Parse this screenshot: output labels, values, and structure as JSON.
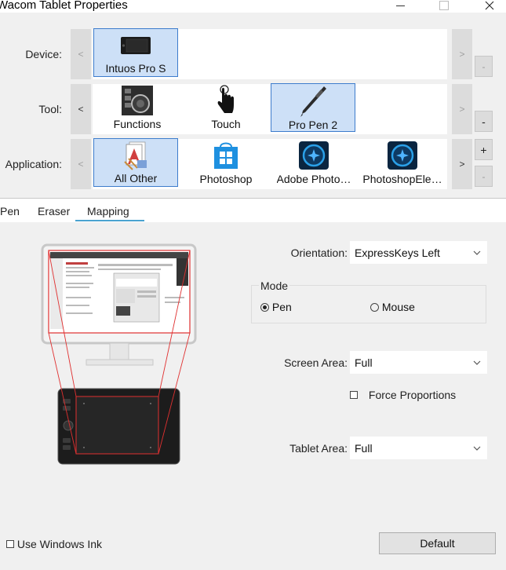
{
  "window": {
    "title": "Wacom Tablet Properties"
  },
  "rows": {
    "device": {
      "label": "Device:",
      "items": [
        {
          "label": "Intuos Pro S",
          "selected": true,
          "icon": "tablet-icon"
        }
      ],
      "side_buttons": [
        "-"
      ]
    },
    "tool": {
      "label": "Tool:",
      "items": [
        {
          "label": "Functions",
          "selected": false,
          "icon": "functions-icon"
        },
        {
          "label": "Touch",
          "selected": false,
          "icon": "touch-hand-icon"
        },
        {
          "label": "Pro Pen 2",
          "selected": true,
          "icon": "pen-icon"
        }
      ],
      "side_buttons": [
        "-"
      ]
    },
    "application": {
      "label": "Application:",
      "items": [
        {
          "label": "All Other",
          "selected": true,
          "icon": "all-other-apps-icon"
        },
        {
          "label": "Photoshop",
          "selected": false,
          "icon": "windows-store-icon"
        },
        {
          "label": "Adobe Photo…",
          "selected": false,
          "icon": "adobe-photoshop-elements-icon"
        },
        {
          "label": "PhotoshopEle…",
          "selected": false,
          "icon": "adobe-photoshop-elements-icon"
        }
      ],
      "side_buttons": [
        "+",
        "-"
      ]
    },
    "scroll_left": "<",
    "scroll_right": ">"
  },
  "tabs": [
    {
      "label": "Pen",
      "active": false
    },
    {
      "label": "Eraser",
      "active": false
    },
    {
      "label": "Mapping",
      "active": true
    }
  ],
  "mapping": {
    "orientation": {
      "label": "Orientation:",
      "value": "ExpressKeys Left"
    },
    "mode": {
      "label": "Mode",
      "options": [
        {
          "label": "Pen",
          "selected": true
        },
        {
          "label": "Mouse",
          "selected": false
        }
      ]
    },
    "screen_area": {
      "label": "Screen Area:",
      "value": "Full"
    },
    "force_proportions": {
      "label": "Force Proportions",
      "checked": false
    },
    "tablet_area": {
      "label": "Tablet Area:",
      "value": "Full"
    },
    "use_windows_ink": {
      "label": "Use Windows Ink",
      "checked": false
    },
    "default_button": "Default"
  },
  "colors": {
    "selection_fill": "#cde0f7",
    "selection_border": "#3d7ccc",
    "tab_underline": "#4aa3d0",
    "mapping_lines": "#e03030",
    "panel_bg": "#f0f0f0"
  }
}
